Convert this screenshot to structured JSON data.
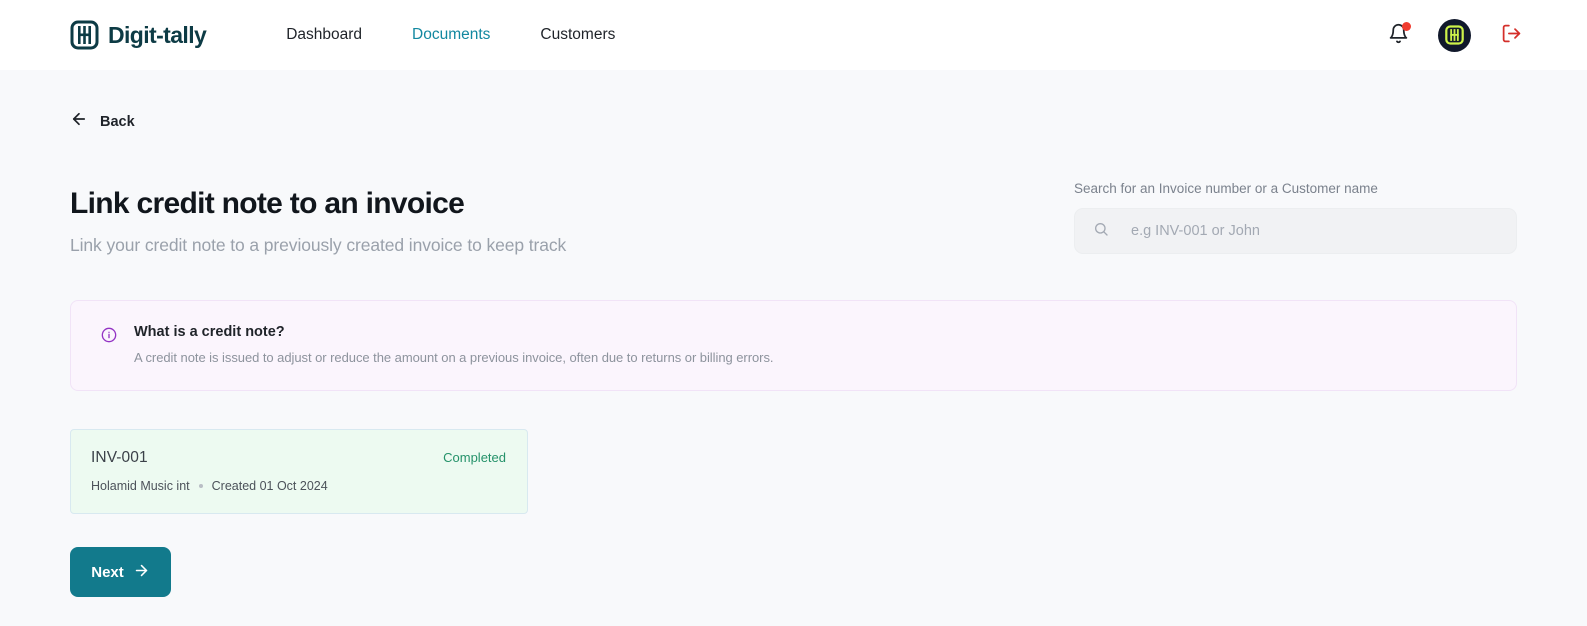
{
  "header": {
    "brand": {
      "name": "Digit-tally",
      "mark_icon": "ledger-logo-icon"
    },
    "nav": [
      {
        "label": "Dashboard",
        "active": false
      },
      {
        "label": "Documents",
        "active": true
      },
      {
        "label": "Customers",
        "active": false
      }
    ],
    "actions": {
      "notifications_icon": "bell-icon",
      "has_unread": true,
      "avatar_icon": "user-avatar",
      "logout_icon": "logout-icon"
    }
  },
  "back": {
    "label": "Back",
    "icon": "arrow-left-icon"
  },
  "main": {
    "title": "Link credit note to an invoice",
    "subtitle": "Link your credit note to a previously created invoice to keep track"
  },
  "search": {
    "label": "Search for an Invoice number or a Customer name",
    "placeholder": "e.g INV-001 or John",
    "value": "",
    "icon": "search-icon"
  },
  "info_banner": {
    "icon": "info-circle-icon",
    "title": "What is a credit note?",
    "text": "A credit note is issued to adjust or reduce the amount on a previous invoice, often due to returns or billing errors."
  },
  "invoice": {
    "number": "INV-001",
    "status": "Completed",
    "customer": "Holamid Music int",
    "created": "Created 01 Oct 2024"
  },
  "next_button": {
    "label": "Next",
    "icon": "arrow-right-icon"
  },
  "colors": {
    "accent_teal": "#127a8c",
    "active_nav": "#1288a0",
    "status_green": "#25926a",
    "banner_bg": "#fbf5fd",
    "banner_icon": "#9333c4",
    "card_bg": "#edfaf1",
    "logout_red": "#d42f2a",
    "avatar_bg": "#10182b",
    "avatar_logo": "#cdf24a",
    "notification_dot": "#f03b2f",
    "page_bg": "#f8f9fb"
  }
}
